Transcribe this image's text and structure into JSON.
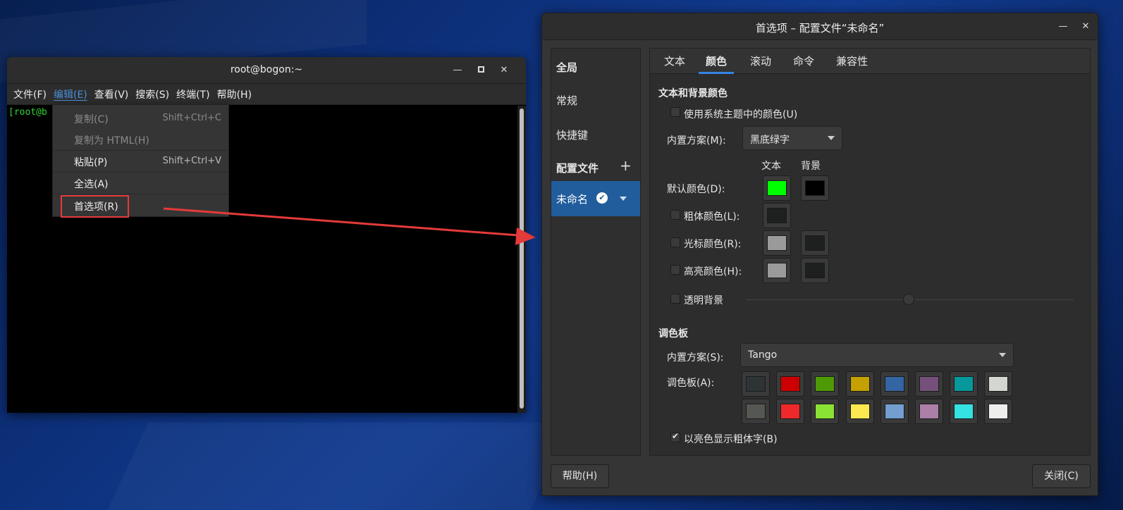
{
  "terminal": {
    "title": "root@bogon:~",
    "menubar": [
      "文件(F)",
      "编辑(E)",
      "查看(V)",
      "搜索(S)",
      "终端(T)",
      "帮助(H)"
    ],
    "prompt": "[root@b",
    "edit_menu": {
      "copy": {
        "label": "复制(C)",
        "shortcut": "Shift+Ctrl+C"
      },
      "copy_html": {
        "label": "复制为 HTML(H)"
      },
      "paste": {
        "label": "粘贴(P)",
        "shortcut": "Shift+Ctrl+V"
      },
      "select_all": {
        "label": "全选(A)"
      },
      "preferences": {
        "label": "首选项(R)"
      }
    }
  },
  "prefs": {
    "title": "首选项 – 配置文件“未命名”",
    "sidebar": {
      "global": "全局",
      "general": "常规",
      "shortcuts": "快捷键",
      "profiles": "配置文件",
      "profile_name": "未命名"
    },
    "tabs": [
      "文本",
      "颜色",
      "滚动",
      "命令",
      "兼容性"
    ],
    "text_bg": {
      "heading": "文本和背景颜色",
      "use_system": "使用系统主题中的颜色(U)",
      "builtin_label": "内置方案(M):",
      "builtin_value": "黑底绿字",
      "col_text": "文本",
      "col_bg": "背景",
      "default_color": "默认颜色(D):",
      "bold_color": "粗体颜色(L):",
      "cursor_color": "光标颜色(R):",
      "highlight_color": "高亮颜色(H):",
      "transparent": "透明背景",
      "colors": {
        "default_text": "#00ff00",
        "default_bg": "#000000",
        "bold": "#1e2020",
        "cursor_text": "#9a9a9a",
        "cursor_bg": "#1e2020",
        "highlight_text": "#9a9a9a",
        "highlight_bg": "#1e2020"
      }
    },
    "palette": {
      "heading": "调色板",
      "builtin_label": "内置方案(S):",
      "builtin_value": "Tango",
      "label": "调色板(A):",
      "row1": [
        "#2e3436",
        "#cc0000",
        "#4e9a06",
        "#c4a000",
        "#3465a4",
        "#75507b",
        "#06989a",
        "#d3d7cf"
      ],
      "row2": [
        "#555753",
        "#ef2929",
        "#8ae234",
        "#fce94f",
        "#729fcf",
        "#ad7fa8",
        "#34e2e2",
        "#eeeeec"
      ],
      "bright_bold": "以亮色显示粗体字(B)"
    },
    "help_button": "帮助(H)",
    "close_button": "关闭(C)"
  }
}
